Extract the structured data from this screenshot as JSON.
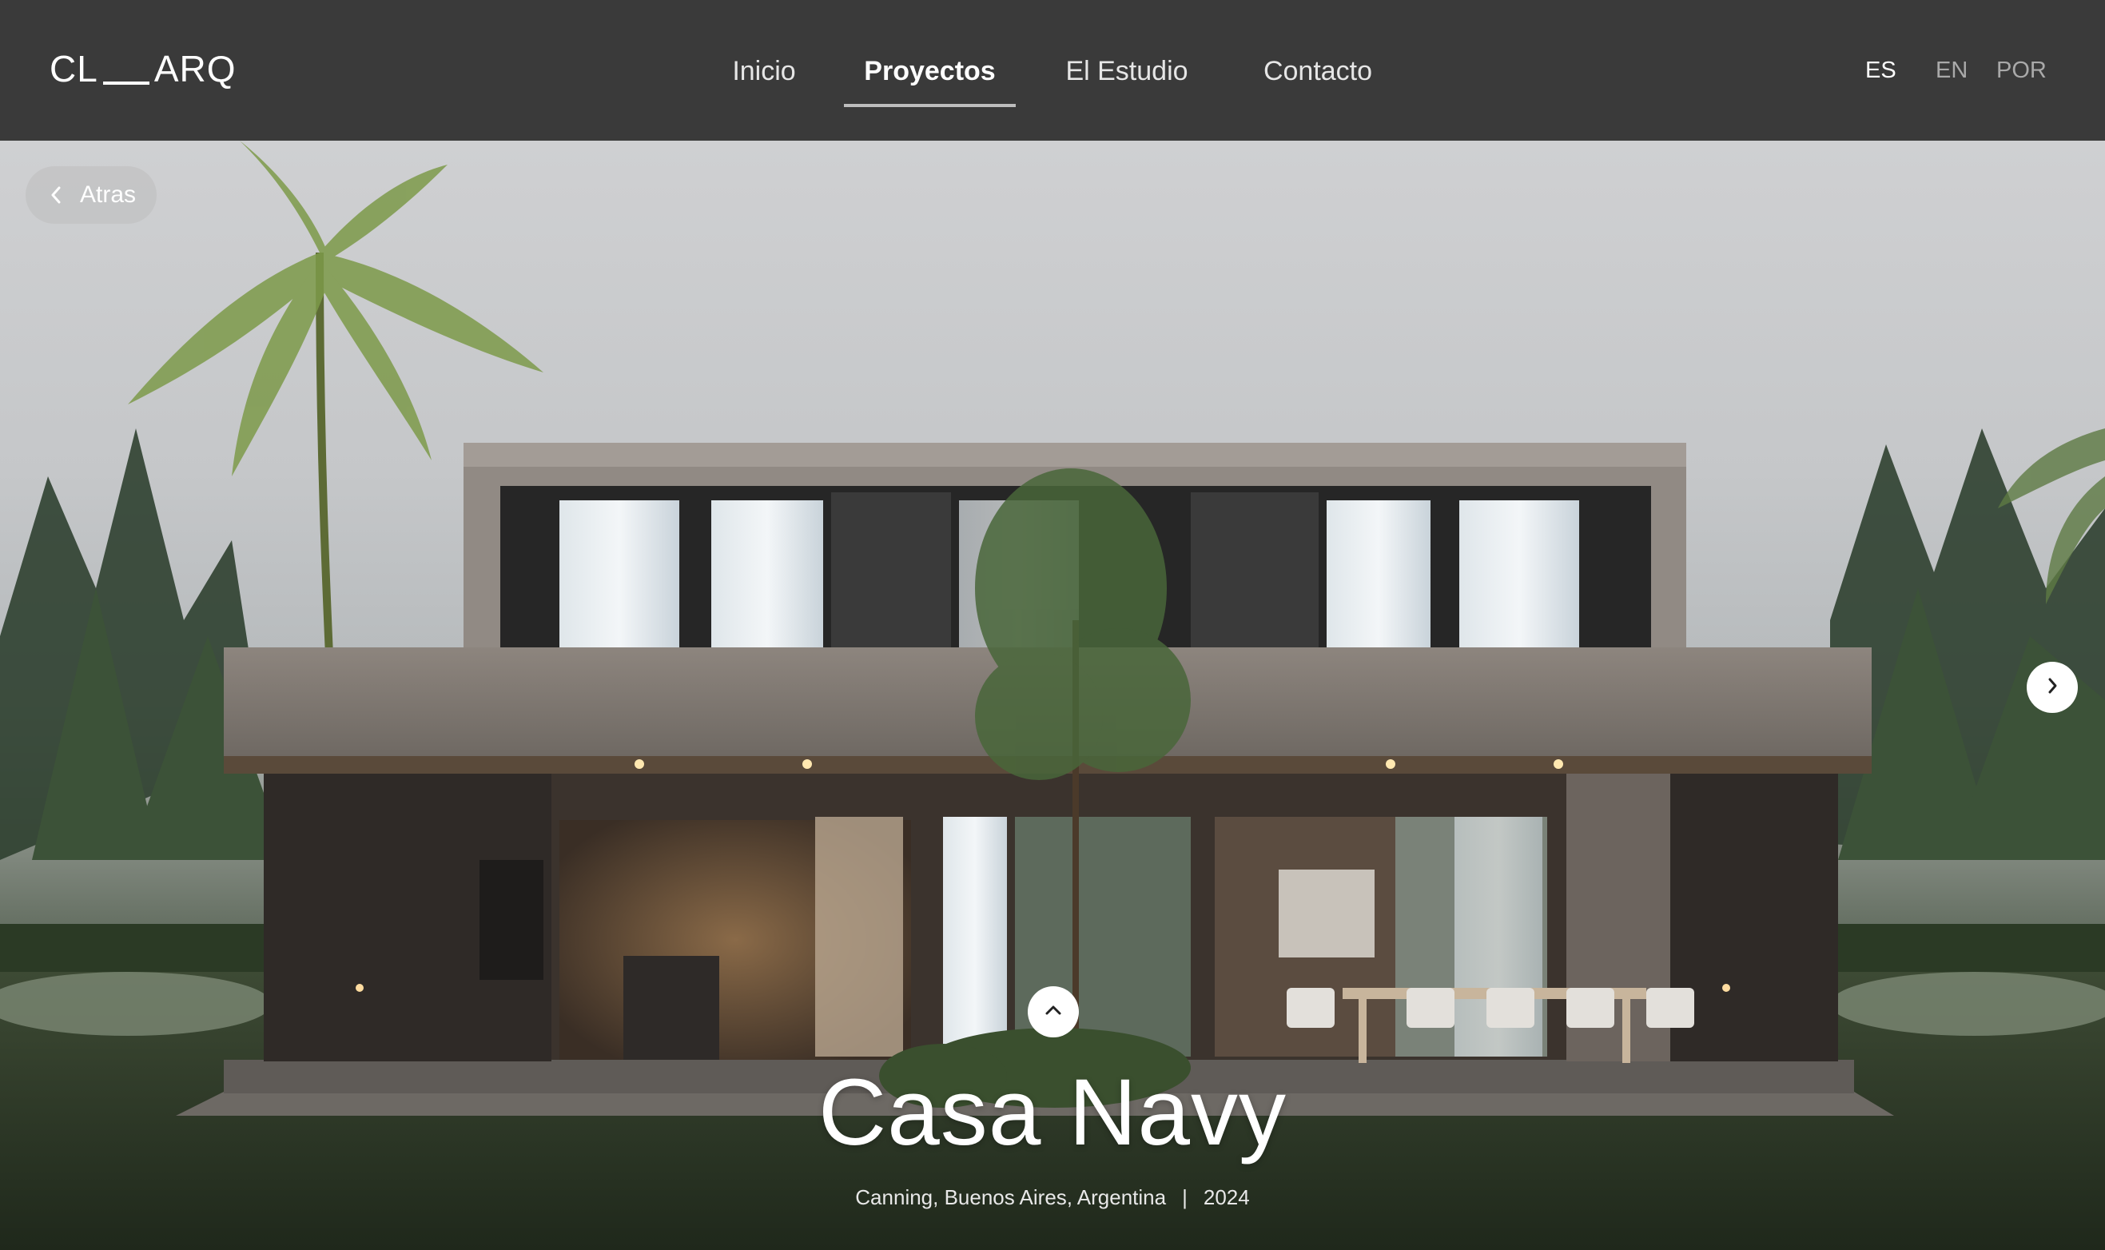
{
  "header": {
    "logo": {
      "left": "CL",
      "right": "ARQ"
    },
    "nav": [
      {
        "label": "Inicio",
        "active": false
      },
      {
        "label": "Proyectos",
        "active": true
      },
      {
        "label": "El Estudio",
        "active": false
      },
      {
        "label": "Contacto",
        "active": false
      }
    ],
    "languages": [
      {
        "label": "ES",
        "active": true
      },
      {
        "label": "EN",
        "active": false
      },
      {
        "label": "POR",
        "active": false
      }
    ]
  },
  "back_button": {
    "label": "Atras",
    "icon": "chevron-left-icon"
  },
  "next_button": {
    "icon": "chevron-right-icon"
  },
  "scroll_up_button": {
    "icon": "chevron-up-icon"
  },
  "project": {
    "title": "Casa Navy",
    "location": "Canning, Buenos Aires, Argentina",
    "separator": "|",
    "year": "2024"
  },
  "colors": {
    "header_bg": "#3a3a3a",
    "text": "#ffffff",
    "muted_text": "#a9a9a9"
  }
}
